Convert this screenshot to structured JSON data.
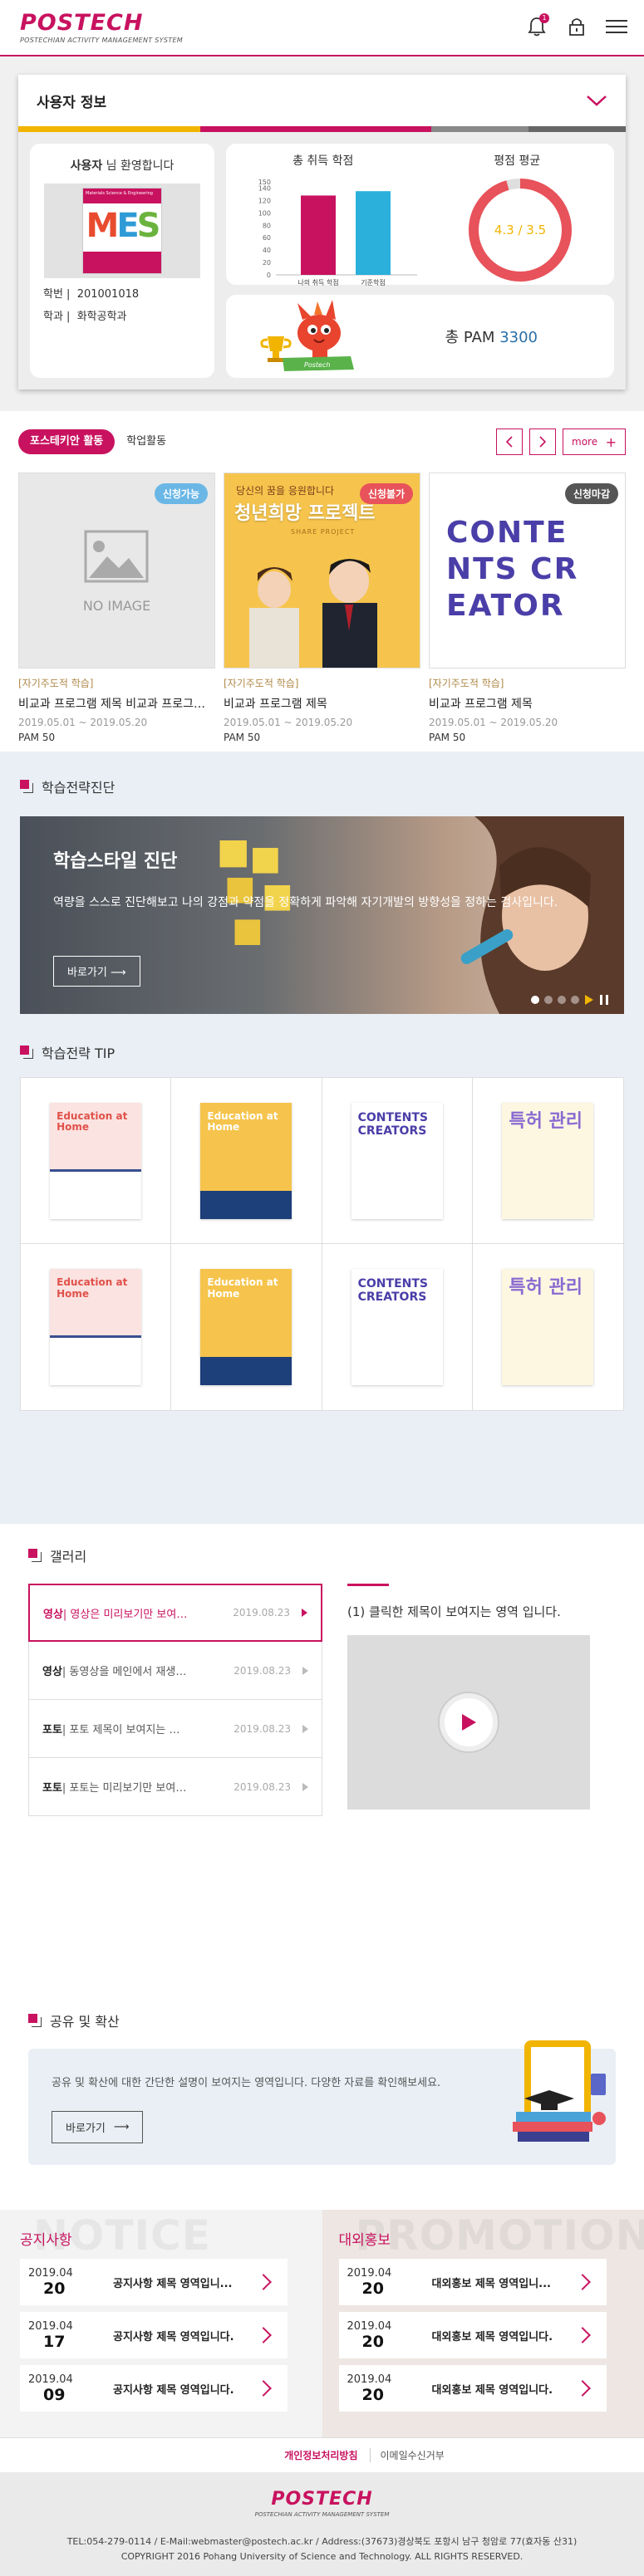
{
  "header": {
    "logo": "POSTECH",
    "logo_sub": "POSTECHIAN ACTIVITY MANAGEMENT SYSTEM",
    "notification_count": "1",
    "icons": [
      "bell-icon",
      "lock-icon",
      "menu-icon"
    ]
  },
  "user": {
    "section_title": "사용자 정보",
    "greeting_name": "사용자",
    "greeting_suffix": " 님 환영합니다",
    "id_label": "학번",
    "id_value": "201001018",
    "dept_label": "학과",
    "dept_value": "화학공학과",
    "mes_header": "Materials Science & Engineering",
    "mes_letters": "MES",
    "credits_title": "총 취득 학점",
    "gpa_title": "평점 평균",
    "gpa_value": "4.3 / 3.5",
    "pam_label": "총 PAM ",
    "pam_value": "3300",
    "colors": {
      "strip": [
        "#f1b400",
        "#c8125f",
        "#7a7a7a",
        "#666666"
      ]
    }
  },
  "chart_data": {
    "type": "bar",
    "categories": [
      "나의 취득 학점",
      "기준학점"
    ],
    "values": [
      128,
      135
    ],
    "colors": [
      "#c8125f",
      "#2ab0db"
    ],
    "yticks": [
      "0",
      "20",
      "40",
      "60",
      "80",
      "100",
      "120",
      "140",
      "150"
    ],
    "ylim": [
      0,
      150
    ]
  },
  "gpa_gauge": {
    "value": 4.3,
    "max": 4.5
  },
  "programs": {
    "tabs": [
      "포스테키안 활동",
      "학업활동"
    ],
    "more_label": "more",
    "items": [
      {
        "badge": "신청가능",
        "badge_color": "#6ab7e6",
        "image": "NO IMAGE",
        "category": "[자기주도적 학습]",
        "title": "비교과 프로그램 제목 비교과 프로그램 제목",
        "date": "2019.05.01 ~ 2019.05.20",
        "pam": "PAM 50"
      },
      {
        "badge": "신청불가",
        "badge_color": "#e8525a",
        "image_title": "청년희망 프로젝트",
        "image_top": "당신의 꿈을 응원합니다",
        "image_sub": "SHARE PROJECT",
        "category": "[자기주도적 학습]",
        "title": "비교과 프로그램 제목",
        "date": "2019.05.01 ~ 2019.05.20",
        "pam": "PAM 50"
      },
      {
        "badge": "신청마감",
        "badge_color": "#555555",
        "image_title": "CONTENTS CREATOR",
        "category": "[자기주도적 학습]",
        "title": "비교과 프로그램 제목",
        "date": "2019.05.01 ~ 2019.05.20",
        "pam": "PAM 50"
      }
    ]
  },
  "diagnosis": {
    "section_title": "학습전략진단",
    "banner_title": "학습스타일 진단",
    "banner_desc": "역량을 스스로 진단해보고 나의 강점과 약점을 정확하게 파악해 자기개발의 방향성을 정하는 검사입니다.",
    "banner_button": "바로가기"
  },
  "tips": {
    "section_title": "학습전략 TIP",
    "books": [
      {
        "kind": "pink",
        "text": "Education at Home"
      },
      {
        "kind": "yellow",
        "text": "Education at Home"
      },
      {
        "kind": "creator",
        "text": "CONTENTS CREATORS"
      },
      {
        "kind": "purple",
        "text": "특허 관리"
      },
      {
        "kind": "pink",
        "text": "Education at Home"
      },
      {
        "kind": "yellow",
        "text": "Education at Home"
      },
      {
        "kind": "creator",
        "text": "CONTENTS CREATORS"
      },
      {
        "kind": "purple",
        "text": "특허 관리"
      }
    ]
  },
  "gallery": {
    "section_title": "갤러리",
    "items": [
      {
        "type": "영상",
        "title": " | 영상은 미리보기만 보여지는 영역",
        "date": "2019.08.23"
      },
      {
        "type": "영상",
        "title": " | 동영상을 메인에서 재생하는 영역",
        "date": "2019.08.23"
      },
      {
        "type": "포토",
        "title": " | 포토 제목이 보여지는 영역",
        "date": "2019.08.23"
      },
      {
        "type": "포토",
        "title": " | 포토는 미리보기만 보여지는 영역",
        "date": "2019.08.23"
      }
    ],
    "preview_caption": "(1) 클릭한 제목이 보여지는 영역 입니다."
  },
  "share": {
    "section_title": "공유 및 확산",
    "desc": "공유 및 확산에 대한 간단한 설명이 보여지는 영역입니다. 다양한 자료를 확인해보세요.",
    "button": "바로가기"
  },
  "notice": {
    "bg_word": "NOTICE",
    "title": "공지사항",
    "items": [
      {
        "ym": "2019.04",
        "day": "20",
        "title": "공지사항 제목 영역입니..."
      },
      {
        "ym": "2019.04",
        "day": "17",
        "title": "공지사항 제목 영역입니다."
      },
      {
        "ym": "2019.04",
        "day": "09",
        "title": "공지사항 제목 영역입니다."
      }
    ]
  },
  "promotion": {
    "bg_word": "PROMOTION",
    "title": "대외홍보",
    "items": [
      {
        "ym": "2019.04",
        "day": "20",
        "title": "대외홍보 제목 영역입니..."
      },
      {
        "ym": "2019.04",
        "day": "20",
        "title": "대외홍보 제목 영역입니다."
      },
      {
        "ym": "2019.04",
        "day": "20",
        "title": "대외홍보 제목 영역입니다."
      }
    ]
  },
  "footer": {
    "privacy": "개인정보처리방침",
    "email_refuse": "이메일수신거부",
    "logo": "POSTECH",
    "logo_sub": "POSTECHIAN ACTIVITY MANAGEMENT SYSTEM",
    "address": "TEL:054-279-0114   /   E-Mail:webmaster@postech.ac.kr   /   Address:(37673)경상북도 포항시 남구 청암로 77(효자동 산31)",
    "copyright": "COPYRIGHT 2016 Pohang University of Science and Technology. ALL RIGHTS RESERVED."
  }
}
